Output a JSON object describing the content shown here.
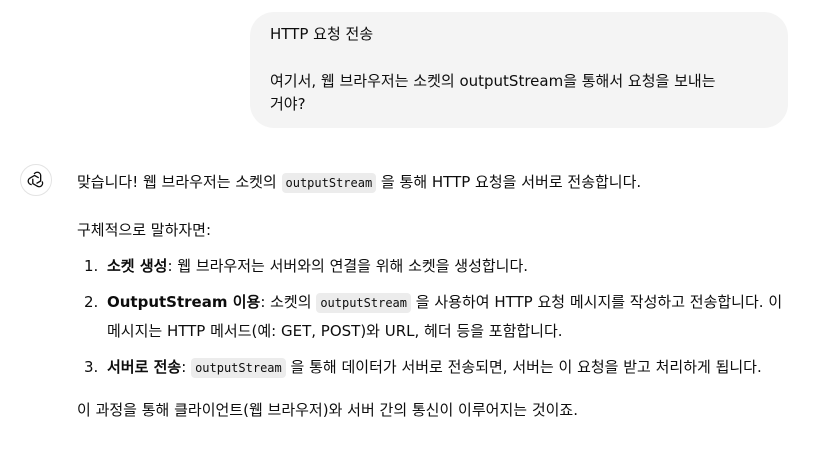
{
  "user_message": {
    "line1": "HTTP 요청 전송",
    "line2": "여기서, 웹 브라우저는 소켓의 outputStream을 통해서 요청을 보내는",
    "line3": "거야?"
  },
  "assistant": {
    "avatar_icon": "openai-logo-icon",
    "intro_pre": "맞습니다! 웹 브라우저는 소켓의 ",
    "intro_code": "outputStream",
    "intro_post": " 을 통해 HTTP 요청을 서버로 전송합니다.",
    "sub_intro": "구체적으로 말하자면:",
    "items": [
      {
        "num": "1.",
        "bold": "소켓 생성",
        "text": ": 웹 브라우저는 서버와의 연결을 위해 소켓을 생성합니다."
      },
      {
        "num": "2.",
        "bold": "OutputStream 이용",
        "pre": ": 소켓의 ",
        "code": "outputStream",
        "post": " 을 사용하여 HTTP 요청 메시지를 작성하고 전송합니다. 이 메시지는 HTTP 메서드(예: GET, POST)와 URL, 헤더 등을 포함합니다."
      },
      {
        "num": "3.",
        "bold": "서버로 전송",
        "pre": ": ",
        "code": "outputStream",
        "post": " 을 통해 데이터가 서버로 전송되면, 서버는 이 요청을 받고 처리하게 됩니다."
      }
    ],
    "outro": "이 과정을 통해 클라이언트(웹 브라우저)와 서버 간의 통신이 이루어지는 것이죠."
  }
}
